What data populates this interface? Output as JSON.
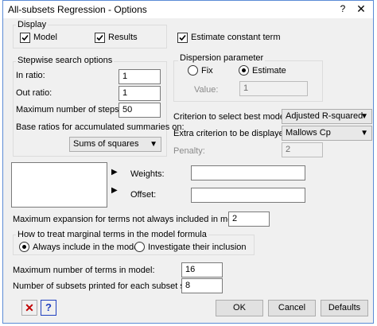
{
  "window": {
    "title": "All-subsets Regression - Options",
    "help_label": "?",
    "close_label": "✕"
  },
  "display": {
    "group_label": "Display",
    "model_label": "Model",
    "model_checked": true,
    "results_label": "Results",
    "results_checked": true
  },
  "estimate_constant": {
    "label": "Estimate constant term",
    "checked": true
  },
  "stepwise": {
    "group_label": "Stepwise search options",
    "in_ratio_label": "In ratio:",
    "in_ratio_value": "1",
    "out_ratio_label": "Out ratio:",
    "out_ratio_value": "1",
    "max_steps_label": "Maximum number of steps:",
    "max_steps_value": "50",
    "base_ratios_label": "Base ratios for accumulated summaries on:",
    "base_ratios_value": "Sums of squares"
  },
  "dispersion": {
    "group_label": "Dispersion parameter",
    "fix_label": "Fix",
    "estimate_label": "Estimate",
    "selected": "Estimate",
    "value_label": "Value:",
    "value_value": "1"
  },
  "criterion": {
    "label": "Criterion to select best model:",
    "value": "Adjusted R-squared",
    "extra_label": "Extra criterion to be displayed:",
    "extra_value": "Mallows Cp",
    "penalty_label": "Penalty:",
    "penalty_value": "2"
  },
  "weights": {
    "label": "Weights:",
    "value": ""
  },
  "offset": {
    "label": "Offset:",
    "value": ""
  },
  "max_expansion": {
    "label": "Maximum expansion for terms not always included in model:",
    "value": "2"
  },
  "marginal": {
    "group_label": "How to treat marginal terms in the model formula",
    "always_label": "Always include in the model",
    "investigate_label": "Investigate their inclusion",
    "selected": "Always include in the model"
  },
  "max_terms": {
    "label": "Maximum number of terms in model:",
    "value": "16"
  },
  "subsets_printed": {
    "label": "Number of subsets printed for each subset size:",
    "value": "8"
  },
  "buttons": {
    "ok": "OK",
    "cancel": "Cancel",
    "defaults": "Defaults"
  },
  "colors": {
    "accent": "#5b8bd6",
    "cancel_icon": "#c00000",
    "help_icon": "#1f3fbf"
  }
}
